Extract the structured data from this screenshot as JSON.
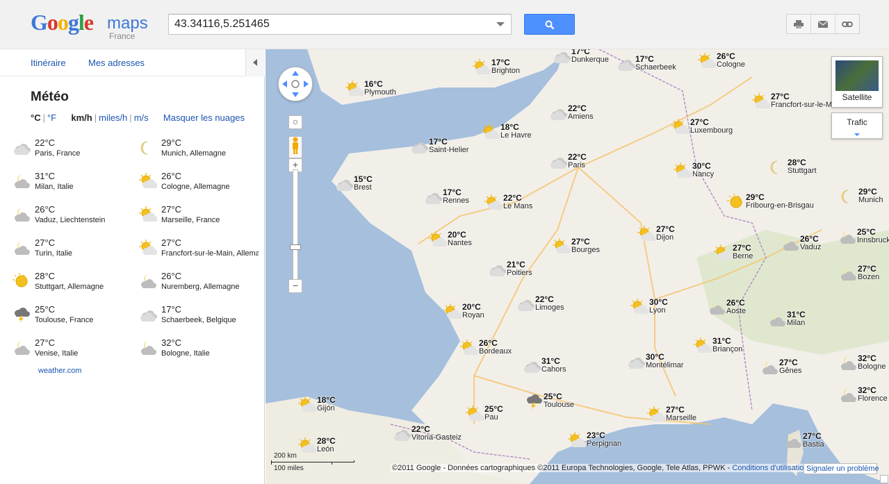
{
  "header": {
    "logo_text": "Google",
    "logo_product": "maps",
    "logo_country": "France",
    "search_value": "43.34116,5.251465",
    "tools": [
      "print-icon",
      "mail-icon",
      "link-icon"
    ]
  },
  "nav": {
    "directions": "Itinéraire",
    "my_places": "Mes adresses"
  },
  "weather": {
    "title": "Météo",
    "units": {
      "celsius": "°C",
      "fahrenheit": "°F",
      "kmh": "km/h",
      "mph": "miles/h",
      "ms": "m/s",
      "hide_clouds": "Masquer les nuages"
    },
    "credit": "weather.com",
    "cities": [
      {
        "temp": "22°C",
        "name": "Paris, France",
        "icon": "cloudy-icon"
      },
      {
        "temp": "29°C",
        "name": "Munich, Allemagne",
        "icon": "moon-icon"
      },
      {
        "temp": "31°C",
        "name": "Milan, Italie",
        "icon": "partly-cloudy-night-icon"
      },
      {
        "temp": "26°C",
        "name": "Cologne, Allemagne",
        "icon": "partly-sunny-icon"
      },
      {
        "temp": "26°C",
        "name": "Vaduz, Liechtenstein",
        "icon": "partly-cloudy-night-icon"
      },
      {
        "temp": "27°C",
        "name": "Marseille, France",
        "icon": "partly-sunny-icon"
      },
      {
        "temp": "27°C",
        "name": "Turin, Italie",
        "icon": "partly-cloudy-night-icon"
      },
      {
        "temp": "27°C",
        "name": "Francfort-sur-le-Main, Allemagne",
        "icon": "partly-sunny-icon"
      },
      {
        "temp": "28°C",
        "name": "Stuttgart, Allemagne",
        "icon": "sun-icon"
      },
      {
        "temp": "26°C",
        "name": "Nuremberg, Allemagne",
        "icon": "partly-cloudy-night-icon"
      },
      {
        "temp": "25°C",
        "name": "Toulouse, France",
        "icon": "thunderstorm-icon"
      },
      {
        "temp": "17°C",
        "name": "Schaerbeek, Belgique",
        "icon": "cloudy-icon"
      },
      {
        "temp": "27°C",
        "name": "Venise, Italie",
        "icon": "partly-cloudy-night-icon"
      },
      {
        "temp": "32°C",
        "name": "Bologne, Italie",
        "icon": "partly-cloudy-night-icon"
      }
    ]
  },
  "map": {
    "markers": [
      {
        "temp": "17°C",
        "city": "Dunkerque",
        "icon": "cloudy-icon"
      },
      {
        "temp": "17°C",
        "city": "Schaerbeek",
        "icon": "cloudy-icon"
      },
      {
        "temp": "26°C",
        "city": "Cologne",
        "icon": "partly-sunny-icon"
      },
      {
        "temp": "17°C",
        "city": "Brighton",
        "icon": "partly-sunny-icon"
      },
      {
        "temp": "16°C",
        "city": "Plymouth",
        "icon": "partly-sunny-icon"
      },
      {
        "temp": "27°C",
        "city": "Francfort-sur-le-Main",
        "icon": "partly-sunny-icon"
      },
      {
        "temp": "22°C",
        "city": "Amiens",
        "icon": "cloudy-icon"
      },
      {
        "temp": "18°C",
        "city": "Le Havre",
        "icon": "partly-sunny-icon"
      },
      {
        "temp": "27°C",
        "city": "Luxembourg",
        "icon": "partly-sunny-icon"
      },
      {
        "temp": "17°C",
        "city": "Saint-Helier",
        "icon": "cloudy-icon"
      },
      {
        "temp": "22°C",
        "city": "Paris",
        "icon": "cloudy-icon"
      },
      {
        "temp": "28°C",
        "city": "Stuttgart",
        "icon": "moon-icon"
      },
      {
        "temp": "30°C",
        "city": "Nancy",
        "icon": "partly-sunny-icon"
      },
      {
        "temp": "15°C",
        "city": "Brest",
        "icon": "cloudy-icon"
      },
      {
        "temp": "17°C",
        "city": "Rennes",
        "icon": "cloudy-icon"
      },
      {
        "temp": "22°C",
        "city": "Le Mans",
        "icon": "partly-sunny-icon"
      },
      {
        "temp": "29°C",
        "city": "Fribourg-en-Brisgau",
        "icon": "sun-icon"
      },
      {
        "temp": "29°C",
        "city": "Munich",
        "icon": "moon-icon"
      },
      {
        "temp": "20°C",
        "city": "Nantes",
        "icon": "partly-sunny-icon"
      },
      {
        "temp": "27°C",
        "city": "Dijon",
        "icon": "partly-sunny-icon"
      },
      {
        "temp": "27°C",
        "city": "Bourges",
        "icon": "partly-sunny-icon"
      },
      {
        "temp": "26°C",
        "city": "Vaduz",
        "icon": "partly-cloudy-night-icon"
      },
      {
        "temp": "25°C",
        "city": "Innsbruck",
        "icon": "partly-cloudy-night-icon"
      },
      {
        "temp": "27°C",
        "city": "Berne",
        "icon": "partly-sunny-icon"
      },
      {
        "temp": "21°C",
        "city": "Poitiers",
        "icon": "cloudy-icon"
      },
      {
        "temp": "27°C",
        "city": "Bozen",
        "icon": "partly-cloudy-night-icon"
      },
      {
        "temp": "22°C",
        "city": "Limoges",
        "icon": "cloudy-icon"
      },
      {
        "temp": "20°C",
        "city": "Royan",
        "icon": "partly-sunny-icon"
      },
      {
        "temp": "30°C",
        "city": "Lyon",
        "icon": "partly-sunny-icon"
      },
      {
        "temp": "26°C",
        "city": "Aoste",
        "icon": "partly-cloudy-night-icon"
      },
      {
        "temp": "31°C",
        "city": "Milan",
        "icon": "partly-cloudy-night-icon"
      },
      {
        "temp": "26°C",
        "city": "Bordeaux",
        "icon": "partly-sunny-icon"
      },
      {
        "temp": "31°C",
        "city": "Briançon",
        "icon": "partly-sunny-icon"
      },
      {
        "temp": "30°C",
        "city": "Montélimar",
        "icon": "cloudy-icon"
      },
      {
        "temp": "31°C",
        "city": "Cahors",
        "icon": "cloudy-icon"
      },
      {
        "temp": "27°C",
        "city": "Gênes",
        "icon": "partly-cloudy-night-icon"
      },
      {
        "temp": "32°C",
        "city": "Bologne",
        "icon": "partly-cloudy-night-icon"
      },
      {
        "temp": "32°C",
        "city": "Florence",
        "icon": "partly-cloudy-night-icon"
      },
      {
        "temp": "18°C",
        "city": "Gijón",
        "icon": "partly-sunny-icon"
      },
      {
        "temp": "25°C",
        "city": "Toulouse",
        "icon": "thunderstorm-icon"
      },
      {
        "temp": "25°C",
        "city": "Pau",
        "icon": "partly-sunny-icon"
      },
      {
        "temp": "27°C",
        "city": "Marseille",
        "icon": "partly-sunny-icon"
      },
      {
        "temp": "22°C",
        "city": "Vitoria-Gasteiz",
        "icon": "cloudy-icon"
      },
      {
        "temp": "28°C",
        "city": "León",
        "icon": "partly-sunny-icon"
      },
      {
        "temp": "23°C",
        "city": "Perpignan",
        "icon": "partly-sunny-icon"
      },
      {
        "temp": "27°C",
        "city": "Bastia",
        "icon": "partly-cloudy-night-icon"
      }
    ],
    "satellite_label": "Satellite",
    "traffic_label": "Trafic",
    "scale_km": "200 km",
    "scale_miles": "100 miles",
    "copyright": "©2011 Google - Données cartographiques ©2011 Europa Technologies, Google, Tele Atlas, PPWK - ",
    "terms_link": "Conditions d'utilisation",
    "report_label": "Signaler un problème"
  }
}
